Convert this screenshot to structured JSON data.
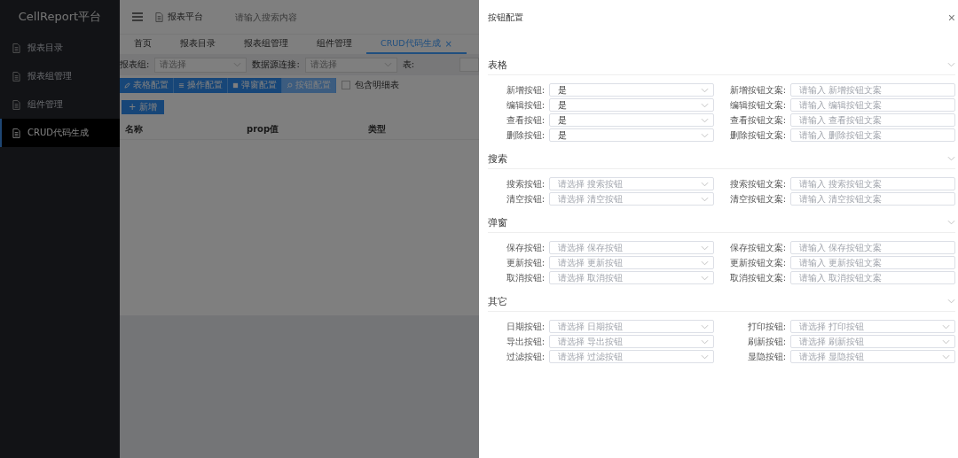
{
  "sidebar": {
    "logo": "CellReport平台",
    "items": [
      {
        "label": "报表目录",
        "selected": false
      },
      {
        "label": "报表组管理",
        "selected": false
      },
      {
        "label": "组件管理",
        "selected": false
      },
      {
        "label": "CRUD代码生成",
        "selected": true
      }
    ]
  },
  "header": {
    "breadcrumb": "报表平台",
    "search": {
      "placeholder": "请输入搜索内容"
    }
  },
  "tabs": [
    {
      "label": "首页",
      "selected": false
    },
    {
      "label": "报表目录",
      "selected": false
    },
    {
      "label": "报表组管理",
      "selected": false
    },
    {
      "label": "组件管理",
      "selected": false
    },
    {
      "label": "CRUD代码生成",
      "selected": true,
      "close": "×"
    }
  ],
  "filters": [
    {
      "label": "报表组:",
      "placeholder": "请选择"
    },
    {
      "label": "数据源连接:",
      "placeholder": "请选择"
    },
    {
      "label": "表:"
    }
  ],
  "config_buttons": [
    {
      "label": "表格配置",
      "selected": false
    },
    {
      "label": "操作配置",
      "selected": false
    },
    {
      "label": "弹窗配置",
      "selected": false
    },
    {
      "label": "按钮配置",
      "selected": true
    }
  ],
  "include_detail": {
    "label": "包含明细表",
    "checked": false
  },
  "add_button": "+ 新增",
  "table": {
    "columns": [
      "名称",
      "prop值",
      "类型"
    ]
  },
  "drawer": {
    "title": "按钮配置",
    "close": "×",
    "sections": [
      {
        "title": "表格",
        "fields": [
          {
            "label": "新增按钮:",
            "kind": "select",
            "value": "是"
          },
          {
            "label": "新增按钮文案:",
            "kind": "input",
            "placeholder": "请输入 新增按钮文案"
          },
          {
            "label": "编辑按钮:",
            "kind": "select",
            "value": "是"
          },
          {
            "label": "编辑按钮文案:",
            "kind": "input",
            "placeholder": "请输入 编辑按钮文案"
          },
          {
            "label": "查看按钮:",
            "kind": "select",
            "value": "是"
          },
          {
            "label": "查看按钮文案:",
            "kind": "input",
            "placeholder": "请输入 查看按钮文案"
          },
          {
            "label": "删除按钮:",
            "kind": "select",
            "value": "是"
          },
          {
            "label": "删除按钮文案:",
            "kind": "input",
            "placeholder": "请输入 删除按钮文案"
          }
        ]
      },
      {
        "title": "搜索",
        "fields": [
          {
            "label": "搜索按钮:",
            "kind": "select",
            "placeholder": "请选择 搜索按钮"
          },
          {
            "label": "搜索按钮文案:",
            "kind": "input",
            "placeholder": "请输入 搜索按钮文案"
          },
          {
            "label": "清空按钮:",
            "kind": "select",
            "placeholder": "请选择 清空按钮"
          },
          {
            "label": "清空按钮文案:",
            "kind": "input",
            "placeholder": "请输入 清空按钮文案"
          }
        ]
      },
      {
        "title": "弹窗",
        "fields": [
          {
            "label": "保存按钮:",
            "kind": "select",
            "placeholder": "请选择 保存按钮"
          },
          {
            "label": "保存按钮文案:",
            "kind": "input",
            "placeholder": "请输入 保存按钮文案"
          },
          {
            "label": "更新按钮:",
            "kind": "select",
            "placeholder": "请选择 更新按钮"
          },
          {
            "label": "更新按钮文案:",
            "kind": "input",
            "placeholder": "请输入 更新按钮文案"
          },
          {
            "label": "取消按钮:",
            "kind": "select",
            "placeholder": "请选择 取消按钮"
          },
          {
            "label": "取消按钮文案:",
            "kind": "input",
            "placeholder": "请输入 取消按钮文案"
          }
        ]
      },
      {
        "title": "其它",
        "fields": [
          {
            "label": "日期按钮:",
            "kind": "select",
            "placeholder": "请选择 日期按钮"
          },
          {
            "label": "打印按钮:",
            "kind": "select",
            "placeholder": "请选择 打印按钮"
          },
          {
            "label": "导出按钮:",
            "kind": "select",
            "placeholder": "请选择 导出按钮"
          },
          {
            "label": "刷新按钮:",
            "kind": "select",
            "placeholder": "请选择 刷新按钮"
          },
          {
            "label": "过滤按钮:",
            "kind": "select",
            "placeholder": "请选择 过滤按钮"
          },
          {
            "label": "显隐按钮:",
            "kind": "select",
            "placeholder": "请选择 显隐按钮"
          }
        ]
      }
    ]
  }
}
